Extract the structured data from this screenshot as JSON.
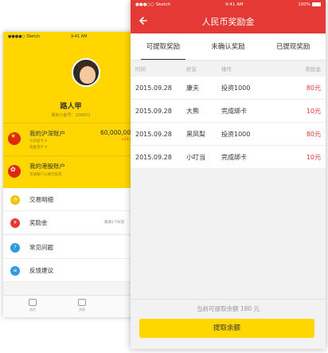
{
  "back": {
    "status": {
      "carrier": "●●●●○ Sketch",
      "time": "9:41 AM"
    },
    "profile": {
      "name": "路人甲",
      "uid": "我的小金号：100001"
    },
    "accounts": [
      {
        "title": "我的沪深账户",
        "line1": "今日盈亏 ¥",
        "line2": "现金资产 ¥",
        "amount": "60,000,00",
        "change": "+23.4"
      },
      {
        "title": "我的港股账户",
        "line1": "充值账户以进行投资"
      }
    ],
    "menu1": [
      {
        "label": "交易明细",
        "icon": "clock-icon",
        "color": "#f2c200",
        "glyph": "◔"
      },
      {
        "label": "奖励金",
        "icon": "reward-icon",
        "color": "#e53935",
        "glyph": "¥",
        "hint": "邀请1个好友"
      }
    ],
    "menu2": [
      {
        "label": "常见问题",
        "icon": "question-icon",
        "color": "#2f9be0",
        "glyph": "?"
      },
      {
        "label": "反馈建议",
        "icon": "feedback-icon",
        "color": "#2f9be0",
        "glyph": "≡"
      }
    ],
    "tabbar": [
      {
        "label": "首页"
      },
      {
        "label": "消息"
      }
    ]
  },
  "front": {
    "status": {
      "carrier": "●●●○○ Sketch",
      "time": "9:41 AM",
      "battery": "100%"
    },
    "title": "人民币奖励金",
    "tabs": [
      "可提取奖励",
      "未确认奖励",
      "已提现奖励"
    ],
    "columns": {
      "time": "时间",
      "friend": "好友",
      "op": "操作",
      "amount": "奖励金"
    },
    "rows": [
      {
        "date": "2015.09.28",
        "friend": "康夫",
        "op": "投资1000",
        "amount": "80元"
      },
      {
        "date": "2015.09.28",
        "friend": "大熊",
        "op": "完成绑卡",
        "amount": "10元"
      },
      {
        "date": "2015.09.28",
        "friend": "黑凤梨",
        "op": "投资1000",
        "amount": "80元"
      },
      {
        "date": "2015.09.28",
        "friend": "小叮当",
        "op": "完成绑卡",
        "amount": "10元"
      }
    ],
    "balance": "当前可提取余额 180 元",
    "withdraw": "提取余额"
  },
  "colors": {
    "red": "#e53935",
    "yellow": "#ffd600"
  }
}
